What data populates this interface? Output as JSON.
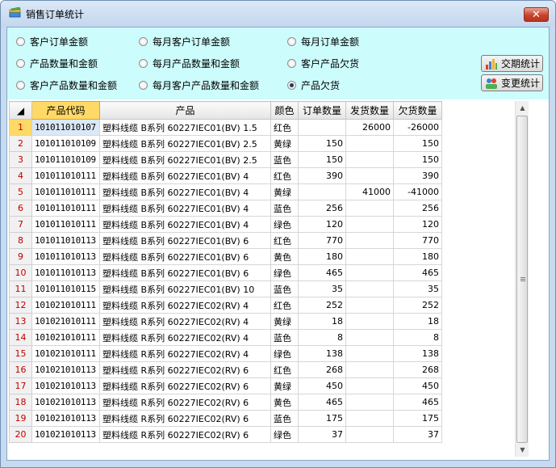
{
  "window": {
    "title": "销售订单统计",
    "close_label": "✕"
  },
  "options": [
    {
      "label": "客户订单金额",
      "selected": false
    },
    {
      "label": "每月客户订单金额",
      "selected": false
    },
    {
      "label": "每月订单金额",
      "selected": false
    },
    {
      "label": "产品数量和金额",
      "selected": false
    },
    {
      "label": "每月产品数量和金额",
      "selected": false
    },
    {
      "label": "客户产品欠货",
      "selected": false
    },
    {
      "label": "客户产品数量和金额",
      "selected": false
    },
    {
      "label": "每月客户产品数量和金额",
      "selected": false
    },
    {
      "label": "产品欠货",
      "selected": true
    }
  ],
  "buttons": {
    "period_stats": "交期统计",
    "change_stats": "变更统计"
  },
  "grid": {
    "columns": [
      "产品代码",
      "产品",
      "颜色",
      "订单数量",
      "发货数量",
      "欠货数量"
    ],
    "rows": [
      {
        "n": "1",
        "code": "101011010107",
        "product": "塑料线缆 B系列 60227IEC01(BV) 1.5",
        "color": "红色",
        "order": "",
        "ship": "26000",
        "owe": "-26000"
      },
      {
        "n": "2",
        "code": "101011010109",
        "product": "塑料线缆 B系列 60227IEC01(BV) 2.5",
        "color": "黄绿",
        "order": "150",
        "ship": "",
        "owe": "150"
      },
      {
        "n": "3",
        "code": "101011010109",
        "product": "塑料线缆 B系列 60227IEC01(BV) 2.5",
        "color": "蓝色",
        "order": "150",
        "ship": "",
        "owe": "150"
      },
      {
        "n": "4",
        "code": "101011010111",
        "product": "塑料线缆 B系列 60227IEC01(BV) 4",
        "color": "红色",
        "order": "390",
        "ship": "",
        "owe": "390"
      },
      {
        "n": "5",
        "code": "101011010111",
        "product": "塑料线缆 B系列 60227IEC01(BV) 4",
        "color": "黄绿",
        "order": "",
        "ship": "41000",
        "owe": "-41000"
      },
      {
        "n": "6",
        "code": "101011010111",
        "product": "塑料线缆 B系列 60227IEC01(BV) 4",
        "color": "蓝色",
        "order": "256",
        "ship": "",
        "owe": "256"
      },
      {
        "n": "7",
        "code": "101011010111",
        "product": "塑料线缆 B系列 60227IEC01(BV) 4",
        "color": "绿色",
        "order": "120",
        "ship": "",
        "owe": "120"
      },
      {
        "n": "8",
        "code": "101011010113",
        "product": "塑料线缆 B系列 60227IEC01(BV) 6",
        "color": "红色",
        "order": "770",
        "ship": "",
        "owe": "770"
      },
      {
        "n": "9",
        "code": "101011010113",
        "product": "塑料线缆 B系列 60227IEC01(BV) 6",
        "color": "黄色",
        "order": "180",
        "ship": "",
        "owe": "180"
      },
      {
        "n": "10",
        "code": "101011010113",
        "product": "塑料线缆 B系列 60227IEC01(BV) 6",
        "color": "绿色",
        "order": "465",
        "ship": "",
        "owe": "465"
      },
      {
        "n": "11",
        "code": "101011010115",
        "product": "塑料线缆 B系列 60227IEC01(BV) 10",
        "color": "蓝色",
        "order": "35",
        "ship": "",
        "owe": "35"
      },
      {
        "n": "12",
        "code": "101021010111",
        "product": "塑料线缆 R系列 60227IEC02(RV) 4",
        "color": "红色",
        "order": "252",
        "ship": "",
        "owe": "252"
      },
      {
        "n": "13",
        "code": "101021010111",
        "product": "塑料线缆 R系列 60227IEC02(RV) 4",
        "color": "黄绿",
        "order": "18",
        "ship": "",
        "owe": "18"
      },
      {
        "n": "14",
        "code": "101021010111",
        "product": "塑料线缆 R系列 60227IEC02(RV) 4",
        "color": "蓝色",
        "order": "8",
        "ship": "",
        "owe": "8"
      },
      {
        "n": "15",
        "code": "101021010111",
        "product": "塑料线缆 R系列 60227IEC02(RV) 4",
        "color": "绿色",
        "order": "138",
        "ship": "",
        "owe": "138"
      },
      {
        "n": "16",
        "code": "101021010113",
        "product": "塑料线缆 R系列 60227IEC02(RV) 6",
        "color": "红色",
        "order": "268",
        "ship": "",
        "owe": "268"
      },
      {
        "n": "17",
        "code": "101021010113",
        "product": "塑料线缆 R系列 60227IEC02(RV) 6",
        "color": "黄绿",
        "order": "450",
        "ship": "",
        "owe": "450"
      },
      {
        "n": "18",
        "code": "101021010113",
        "product": "塑料线缆 R系列 60227IEC02(RV) 6",
        "color": "黄色",
        "order": "465",
        "ship": "",
        "owe": "465"
      },
      {
        "n": "19",
        "code": "101021010113",
        "product": "塑料线缆 R系列 60227IEC02(RV) 6",
        "color": "蓝色",
        "order": "175",
        "ship": "",
        "owe": "175"
      },
      {
        "n": "20",
        "code": "101021010113",
        "product": "塑料线缆 R系列 60227IEC02(RV) 6",
        "color": "绿色",
        "order": "37",
        "ship": "",
        "owe": "37"
      }
    ]
  },
  "colors": {
    "options_background": "#cdfcfc",
    "active_header": "#ffd966",
    "row_number_text": "#c00000",
    "selected_cell": "#dbe8f6"
  },
  "icons": {
    "app": "pencil-book-icon",
    "period": "bar-chart-icon",
    "change": "people-chart-icon"
  }
}
